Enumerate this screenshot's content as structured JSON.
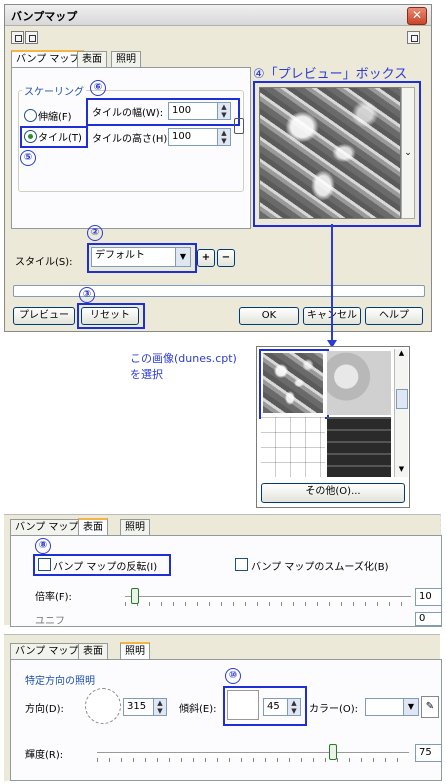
{
  "dialog": {
    "title": "バンプマップ",
    "close": "✕",
    "tabs": [
      "バンプ マップ",
      "表面",
      "照明"
    ],
    "scaling_group": "スケーリング",
    "stretch_label": "伸縮(F)",
    "tile_label": "タイル(T)",
    "tile_width_label": "タイルの幅(W):",
    "tile_width_value": "100",
    "tile_height_label": "タイルの高さ(H):",
    "tile_height_value": "100",
    "preview_box_label": "④「プレビュー」ボックス",
    "style_label": "スタイル(S):",
    "style_value": "デフォルト",
    "plus": "+",
    "minus": "−",
    "preview_button": "プレビュー",
    "reset_button": "リセット",
    "ok_button": "OK",
    "cancel_button": "キャンセル",
    "help_button": "ヘルプ"
  },
  "callouts": {
    "c2": "②",
    "c3": "③",
    "c5": "⑤",
    "c6": "⑥",
    "c8": "⑧",
    "c10": "⑩"
  },
  "picker": {
    "note_line1": "この画像(dunes.cpt)",
    "note_line2": "を選択",
    "more_button": "その他(O)..."
  },
  "surface_panel": {
    "tabs": [
      "バンプ マップ",
      "表面",
      "照明"
    ],
    "invert_label": "バンプ マップの反転(I)",
    "smooth_label": "バンプ マップのスムーズ化(B)",
    "scale_label": "倍率(F):",
    "scale_value": "10",
    "partial_label": "ユニフ",
    "partial_value": "0"
  },
  "lighting_panel": {
    "tabs": [
      "バンプ マップ",
      "表面",
      "照明"
    ],
    "group_label": "特定方向の照明",
    "direction_label": "方向(D):",
    "direction_value": "315",
    "tilt_label": "傾斜(E):",
    "tilt_value": "45",
    "color_label": "カラー(O):",
    "brightness_label": "輝度(R):",
    "brightness_value": "75"
  },
  "colors": {
    "callout": "#2b3bd6",
    "highlight": "#1f2fd8",
    "dialog_bg": "#ece9d8",
    "tab_accent": "#f1b54a"
  }
}
